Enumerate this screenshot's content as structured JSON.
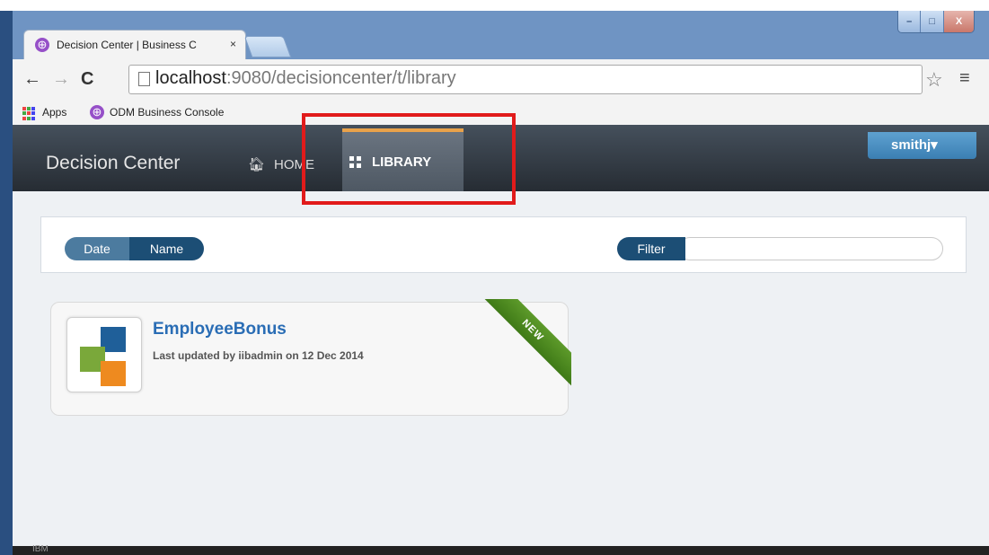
{
  "window": {
    "top_text": "",
    "controls": {
      "minimize": "–",
      "maximize": "□",
      "close": "X"
    }
  },
  "browser": {
    "tab": {
      "title": "Decision Center | Business C",
      "close": "×"
    },
    "nav": {
      "back": "←",
      "forward": "→",
      "reload": "C"
    },
    "url": {
      "host": "localhost",
      "rest": ":9080/decisioncenter/t/library"
    },
    "star": "☆",
    "menu": "≡",
    "bookmarks": [
      {
        "label": "Apps"
      },
      {
        "label": "ODM Business Console"
      }
    ]
  },
  "app": {
    "brand": "Decision Center",
    "nav": {
      "home": "HOME",
      "library": "LIBRARY"
    },
    "user": "smithj▾"
  },
  "toolbar": {
    "sort_options": [
      "Date",
      "Name"
    ],
    "filter_label": "Filter",
    "filter_value": ""
  },
  "projects": [
    {
      "title": "EmployeeBonus",
      "subtitle": "Last updated by iibadmin on 12 Dec 2014",
      "badge": "NEW"
    }
  ],
  "footer": {
    "text": "IBM"
  },
  "colors": {
    "accent": "#e9a24a",
    "link": "#2a6db5",
    "highlight": "#e11b1b",
    "badge": "#4f8a20"
  }
}
